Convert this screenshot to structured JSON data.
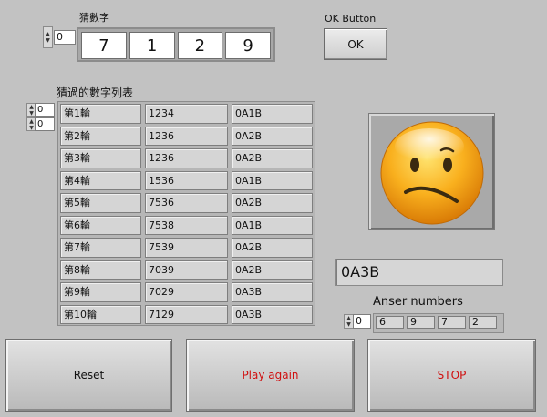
{
  "guess": {
    "label": "猜數字",
    "index": "0",
    "digits": [
      "7",
      "1",
      "2",
      "9"
    ]
  },
  "ok": {
    "label": "OK Button",
    "button": "OK"
  },
  "history": {
    "label": "猜過的數字列表",
    "row_index": "0",
    "col_index": "0",
    "rows": [
      [
        "第1輪",
        "1234",
        "0A1B"
      ],
      [
        "第2輪",
        "1236",
        "0A2B"
      ],
      [
        "第3輪",
        "1236",
        "0A2B"
      ],
      [
        "第4輪",
        "1536",
        "0A1B"
      ],
      [
        "第5輪",
        "7536",
        "0A2B"
      ],
      [
        "第6輪",
        "7538",
        "0A1B"
      ],
      [
        "第7輪",
        "7539",
        "0A2B"
      ],
      [
        "第8輪",
        "7039",
        "0A2B"
      ],
      [
        "第9輪",
        "7029",
        "0A3B"
      ],
      [
        "第10輪",
        "7129",
        "0A3B"
      ]
    ]
  },
  "face": {
    "icon": "sad-face-icon",
    "colors": {
      "face": "#f7a21b",
      "features": "#3a2a10"
    }
  },
  "result": "0A3B",
  "answer": {
    "label": "Anser numbers",
    "index": "0",
    "digits": [
      "6",
      "9",
      "7",
      "2"
    ]
  },
  "buttons": {
    "reset": "Reset",
    "play_again": "Play again",
    "stop": "STOP"
  },
  "colors": {
    "background": "#c2c2c2",
    "accent_text": "#d01010"
  }
}
